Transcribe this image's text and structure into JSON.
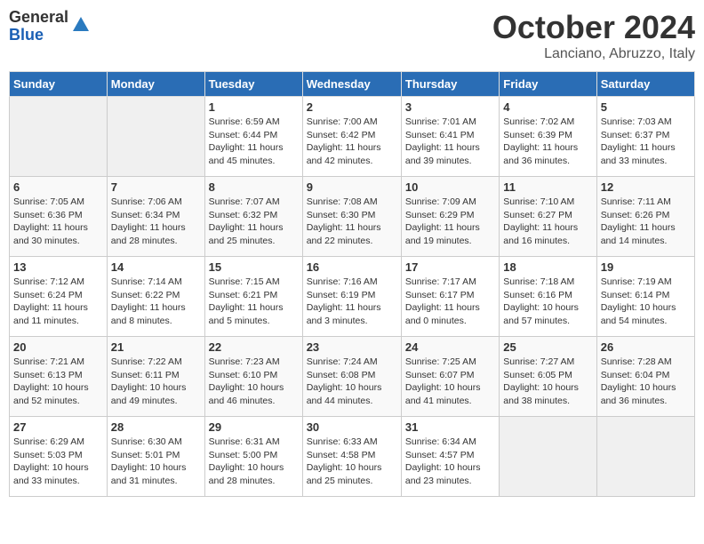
{
  "header": {
    "logo": {
      "line1": "General",
      "line2": "Blue"
    },
    "title": "October 2024",
    "location": "Lanciano, Abruzzo, Italy"
  },
  "weekdays": [
    "Sunday",
    "Monday",
    "Tuesday",
    "Wednesday",
    "Thursday",
    "Friday",
    "Saturday"
  ],
  "weeks": [
    [
      {
        "day": "",
        "info": ""
      },
      {
        "day": "",
        "info": ""
      },
      {
        "day": "1",
        "info": "Sunrise: 6:59 AM\nSunset: 6:44 PM\nDaylight: 11 hours and 45 minutes."
      },
      {
        "day": "2",
        "info": "Sunrise: 7:00 AM\nSunset: 6:42 PM\nDaylight: 11 hours and 42 minutes."
      },
      {
        "day": "3",
        "info": "Sunrise: 7:01 AM\nSunset: 6:41 PM\nDaylight: 11 hours and 39 minutes."
      },
      {
        "day": "4",
        "info": "Sunrise: 7:02 AM\nSunset: 6:39 PM\nDaylight: 11 hours and 36 minutes."
      },
      {
        "day": "5",
        "info": "Sunrise: 7:03 AM\nSunset: 6:37 PM\nDaylight: 11 hours and 33 minutes."
      }
    ],
    [
      {
        "day": "6",
        "info": "Sunrise: 7:05 AM\nSunset: 6:36 PM\nDaylight: 11 hours and 30 minutes."
      },
      {
        "day": "7",
        "info": "Sunrise: 7:06 AM\nSunset: 6:34 PM\nDaylight: 11 hours and 28 minutes."
      },
      {
        "day": "8",
        "info": "Sunrise: 7:07 AM\nSunset: 6:32 PM\nDaylight: 11 hours and 25 minutes."
      },
      {
        "day": "9",
        "info": "Sunrise: 7:08 AM\nSunset: 6:30 PM\nDaylight: 11 hours and 22 minutes."
      },
      {
        "day": "10",
        "info": "Sunrise: 7:09 AM\nSunset: 6:29 PM\nDaylight: 11 hours and 19 minutes."
      },
      {
        "day": "11",
        "info": "Sunrise: 7:10 AM\nSunset: 6:27 PM\nDaylight: 11 hours and 16 minutes."
      },
      {
        "day": "12",
        "info": "Sunrise: 7:11 AM\nSunset: 6:26 PM\nDaylight: 11 hours and 14 minutes."
      }
    ],
    [
      {
        "day": "13",
        "info": "Sunrise: 7:12 AM\nSunset: 6:24 PM\nDaylight: 11 hours and 11 minutes."
      },
      {
        "day": "14",
        "info": "Sunrise: 7:14 AM\nSunset: 6:22 PM\nDaylight: 11 hours and 8 minutes."
      },
      {
        "day": "15",
        "info": "Sunrise: 7:15 AM\nSunset: 6:21 PM\nDaylight: 11 hours and 5 minutes."
      },
      {
        "day": "16",
        "info": "Sunrise: 7:16 AM\nSunset: 6:19 PM\nDaylight: 11 hours and 3 minutes."
      },
      {
        "day": "17",
        "info": "Sunrise: 7:17 AM\nSunset: 6:17 PM\nDaylight: 11 hours and 0 minutes."
      },
      {
        "day": "18",
        "info": "Sunrise: 7:18 AM\nSunset: 6:16 PM\nDaylight: 10 hours and 57 minutes."
      },
      {
        "day": "19",
        "info": "Sunrise: 7:19 AM\nSunset: 6:14 PM\nDaylight: 10 hours and 54 minutes."
      }
    ],
    [
      {
        "day": "20",
        "info": "Sunrise: 7:21 AM\nSunset: 6:13 PM\nDaylight: 10 hours and 52 minutes."
      },
      {
        "day": "21",
        "info": "Sunrise: 7:22 AM\nSunset: 6:11 PM\nDaylight: 10 hours and 49 minutes."
      },
      {
        "day": "22",
        "info": "Sunrise: 7:23 AM\nSunset: 6:10 PM\nDaylight: 10 hours and 46 minutes."
      },
      {
        "day": "23",
        "info": "Sunrise: 7:24 AM\nSunset: 6:08 PM\nDaylight: 10 hours and 44 minutes."
      },
      {
        "day": "24",
        "info": "Sunrise: 7:25 AM\nSunset: 6:07 PM\nDaylight: 10 hours and 41 minutes."
      },
      {
        "day": "25",
        "info": "Sunrise: 7:27 AM\nSunset: 6:05 PM\nDaylight: 10 hours and 38 minutes."
      },
      {
        "day": "26",
        "info": "Sunrise: 7:28 AM\nSunset: 6:04 PM\nDaylight: 10 hours and 36 minutes."
      }
    ],
    [
      {
        "day": "27",
        "info": "Sunrise: 6:29 AM\nSunset: 5:03 PM\nDaylight: 10 hours and 33 minutes."
      },
      {
        "day": "28",
        "info": "Sunrise: 6:30 AM\nSunset: 5:01 PM\nDaylight: 10 hours and 31 minutes."
      },
      {
        "day": "29",
        "info": "Sunrise: 6:31 AM\nSunset: 5:00 PM\nDaylight: 10 hours and 28 minutes."
      },
      {
        "day": "30",
        "info": "Sunrise: 6:33 AM\nSunset: 4:58 PM\nDaylight: 10 hours and 25 minutes."
      },
      {
        "day": "31",
        "info": "Sunrise: 6:34 AM\nSunset: 4:57 PM\nDaylight: 10 hours and 23 minutes."
      },
      {
        "day": "",
        "info": ""
      },
      {
        "day": "",
        "info": ""
      }
    ]
  ]
}
